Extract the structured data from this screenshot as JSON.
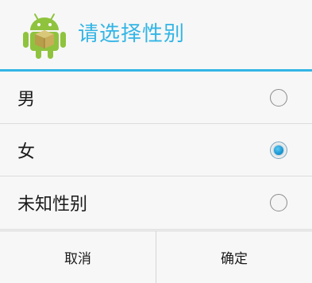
{
  "dialog": {
    "title": "请选择性别",
    "title_icon": "android-icon",
    "accent_color": "#33b5e5"
  },
  "options": [
    {
      "label": "男",
      "checked": false
    },
    {
      "label": "女",
      "checked": true
    },
    {
      "label": "未知性别",
      "checked": false
    }
  ],
  "buttons": {
    "cancel_label": "取消",
    "confirm_label": "确定"
  }
}
